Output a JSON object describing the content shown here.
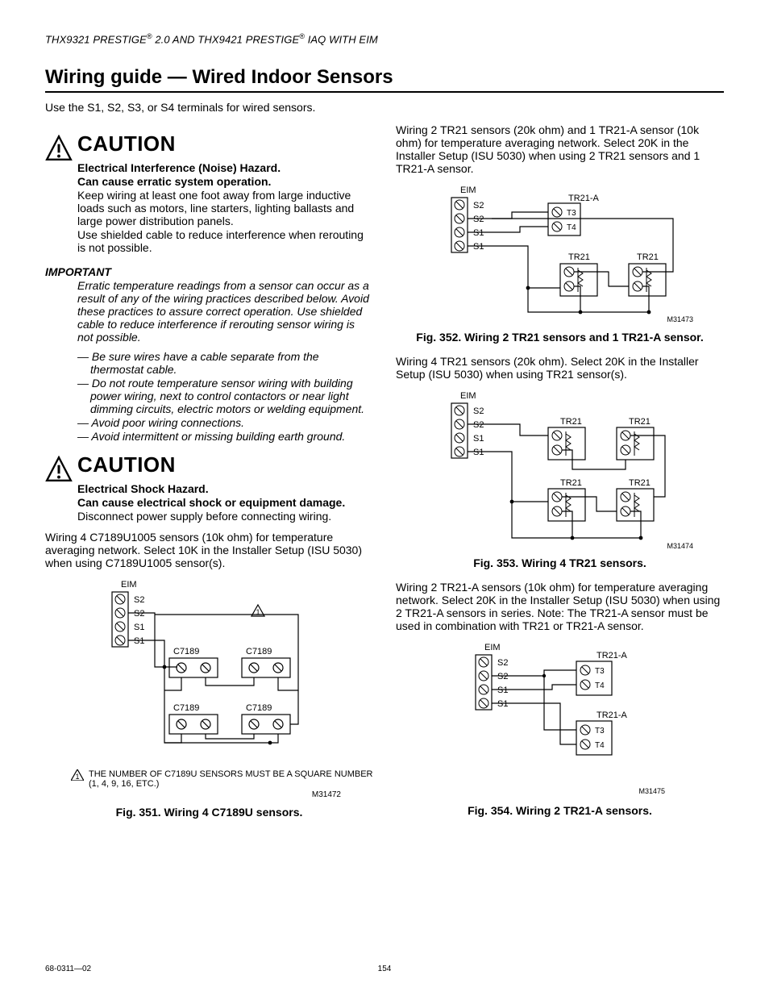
{
  "header": {
    "model_a": "THX9321 PRESTIGE",
    "reg_a": "®",
    "mid": " 2.0 AND THX9421 PRESTIGE",
    "reg_b": "®",
    "tail": " IAQ WITH EIM"
  },
  "title": "Wiring guide — Wired Indoor Sensors",
  "intro": "Use the S1, S2, S3, or S4 terminals for wired sensors.",
  "caution1": {
    "heading": "Caution",
    "line1": "Electrical Interference (Noise) Hazard.",
    "line2": "Can cause erratic system operation.",
    "body1": "Keep wiring at least one foot away from large inductive loads such as motors, line starters, lighting ballasts and large power distribution panels.",
    "body2": "Use shielded cable to reduce interference when rerouting is not possible."
  },
  "important": {
    "heading": "IMPORTANT",
    "body": "Erratic temperature readings from a sensor can occur as a result of any of the wiring practices described below. Avoid these practices to assure correct operation. Use shielded cable to reduce interference if rerouting sensor wiring is not possible.",
    "bullets": [
      "— Be sure wires have a cable separate from the thermostat cable.",
      "— Do not route temperature sensor wiring with building power wiring, next to control contactors or near light dimming circuits, electric motors or welding equipment.",
      "— Avoid poor wiring connections.",
      "— Avoid intermittent or missing building earth ground."
    ]
  },
  "caution2": {
    "heading": "Caution",
    "line1": "Electrical Shock Hazard.",
    "line2": "Can cause electrical shock or equipment damage.",
    "body1": "Disconnect power supply before connecting wiring."
  },
  "para351": "Wiring 4 C7189U1005 sensors (10k ohm) for temperature averaging network. Select 10K in the Installer Setup (ISU 5030) when using C7189U1005 sensor(s).",
  "fig351": {
    "eim": "EIM",
    "terminals": [
      "S2",
      "S2",
      "S1",
      "S1"
    ],
    "sensors": [
      "C7189",
      "C7189",
      "C7189",
      "C7189"
    ],
    "note_tri": "1",
    "footnote": "THE NUMBER OF C7189U SENSORS MUST BE A SQUARE NUMBER (1, 4, 9, 16, ETC.)",
    "mnum": "M31472",
    "caption": "Fig. 351. Wiring 4 C7189U sensors."
  },
  "para352": "Wiring 2 TR21 sensors (20k ohm) and 1 TR21-A sensor (10k ohm) for temperature averaging network. Select 20K in the Installer Setup (ISU 5030) when using 2 TR21 sensors and 1 TR21-A sensor.",
  "fig352": {
    "eim": "EIM",
    "terminals": [
      "S2",
      "S2",
      "S1",
      "S1"
    ],
    "labels": {
      "tr21a": "TR21-A",
      "tr21_1": "TR21",
      "tr21_2": "TR21",
      "t3": "T3",
      "t4": "T4"
    },
    "mnum": "M31473",
    "caption": "Fig. 352. Wiring 2 TR21 sensors and 1 TR21-A sensor."
  },
  "para353": "Wiring 4 TR21 sensors (20k ohm). Select 20K in the Installer Setup (ISU 5030) when using TR21 sensor(s).",
  "fig353": {
    "eim": "EIM",
    "terminals": [
      "S2",
      "S2",
      "S1",
      "S1"
    ],
    "labels": {
      "tr21": "TR21"
    },
    "mnum": "M31474",
    "caption": "Fig. 353. Wiring 4 TR21 sensors."
  },
  "para354": "Wiring 2 TR21-A sensors (10k ohm) for temperature averaging network. Select 20K in the Installer Setup (ISU 5030) when using 2 TR21-A sensors in series. Note: The TR21-A sensor must be used in combination with TR21 or TR21-A sensor.",
  "fig354": {
    "eim": "EIM",
    "terminals": [
      "S2",
      "S2",
      "S1",
      "S1"
    ],
    "labels": {
      "tr21a": "TR21-A",
      "t3": "T3",
      "t4": "T4"
    },
    "mnum": "M31475",
    "caption": "Fig. 354. Wiring 2 TR21-A sensors."
  },
  "footer": {
    "doc": "68-0311—02",
    "page": "154"
  }
}
